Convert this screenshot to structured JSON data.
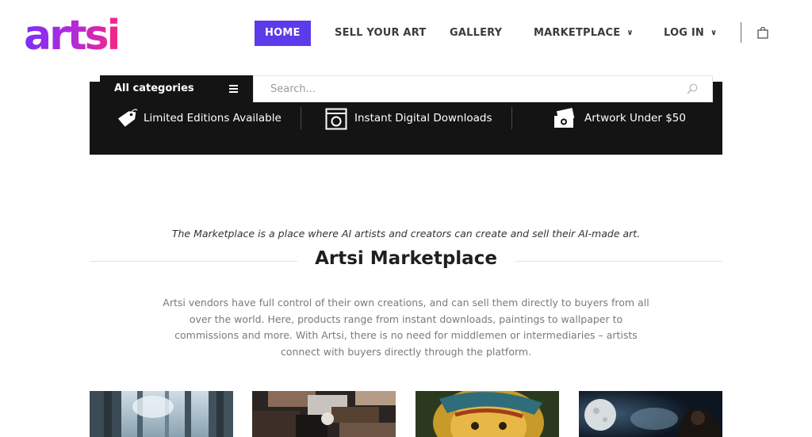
{
  "brand": {
    "logo_text": "artsi"
  },
  "nav": {
    "items": [
      {
        "label": "HOME"
      },
      {
        "label": "SELL YOUR ART"
      },
      {
        "label": "GALLERY"
      },
      {
        "label": "MARKETPLACE"
      },
      {
        "label": "LOG IN"
      }
    ]
  },
  "search": {
    "category_label": "All categories",
    "placeholder": "Search..."
  },
  "features": [
    {
      "icon": "price-tag-icon",
      "label": "Limited Editions Available"
    },
    {
      "icon": "download-frame-icon",
      "label": "Instant Digital Downloads"
    },
    {
      "icon": "money-icon",
      "label": "Artwork Under $50"
    }
  ],
  "intro": {
    "tagline": "The Marketplace is a place where AI artists and creators can create and sell their AI-made art.",
    "title": "Artsi Marketplace",
    "description": "Artsi vendors have full control of their own creations, and can sell them directly to buyers from all over the world. Here, products range from instant downloads, paintings to wallpaper to commissions and more. With Artsi, there is no need for middlemen or intermediaries – artists connect with buyers directly through the platform."
  },
  "colors": {
    "accent": "#5b3bea",
    "banner": "#141414",
    "logo_gradient": [
      "#7b2ff7",
      "#f72585"
    ]
  }
}
